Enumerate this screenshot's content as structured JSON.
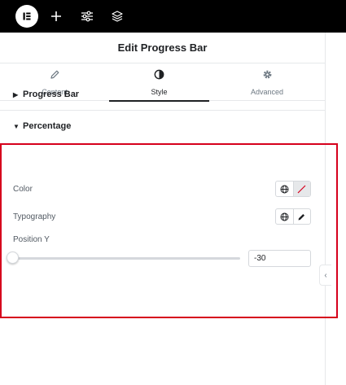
{
  "topbar": {
    "icons": [
      "elementor-logo-icon",
      "plus-icon",
      "sliders-icon",
      "layers-icon"
    ]
  },
  "panel": {
    "title": "Edit Progress Bar",
    "tabs": [
      {
        "label": "Content",
        "icon": "pencil-icon",
        "active": false
      },
      {
        "label": "Style",
        "icon": "contrast-icon",
        "active": true
      },
      {
        "label": "Advanced",
        "icon": "gear-icon",
        "active": false
      }
    ],
    "sections": {
      "progress_bar": {
        "title": "Progress Bar",
        "expanded": false
      },
      "percentage": {
        "title": "Percentage",
        "expanded": true,
        "color_label": "Color",
        "typography_label": "Typography",
        "position_label": "Position Y",
        "position_value": "-30"
      }
    }
  },
  "colors": {
    "topbar": "#000000",
    "highlight": "#d6001c",
    "text": "#1f2124",
    "muted": "#6d7882"
  }
}
